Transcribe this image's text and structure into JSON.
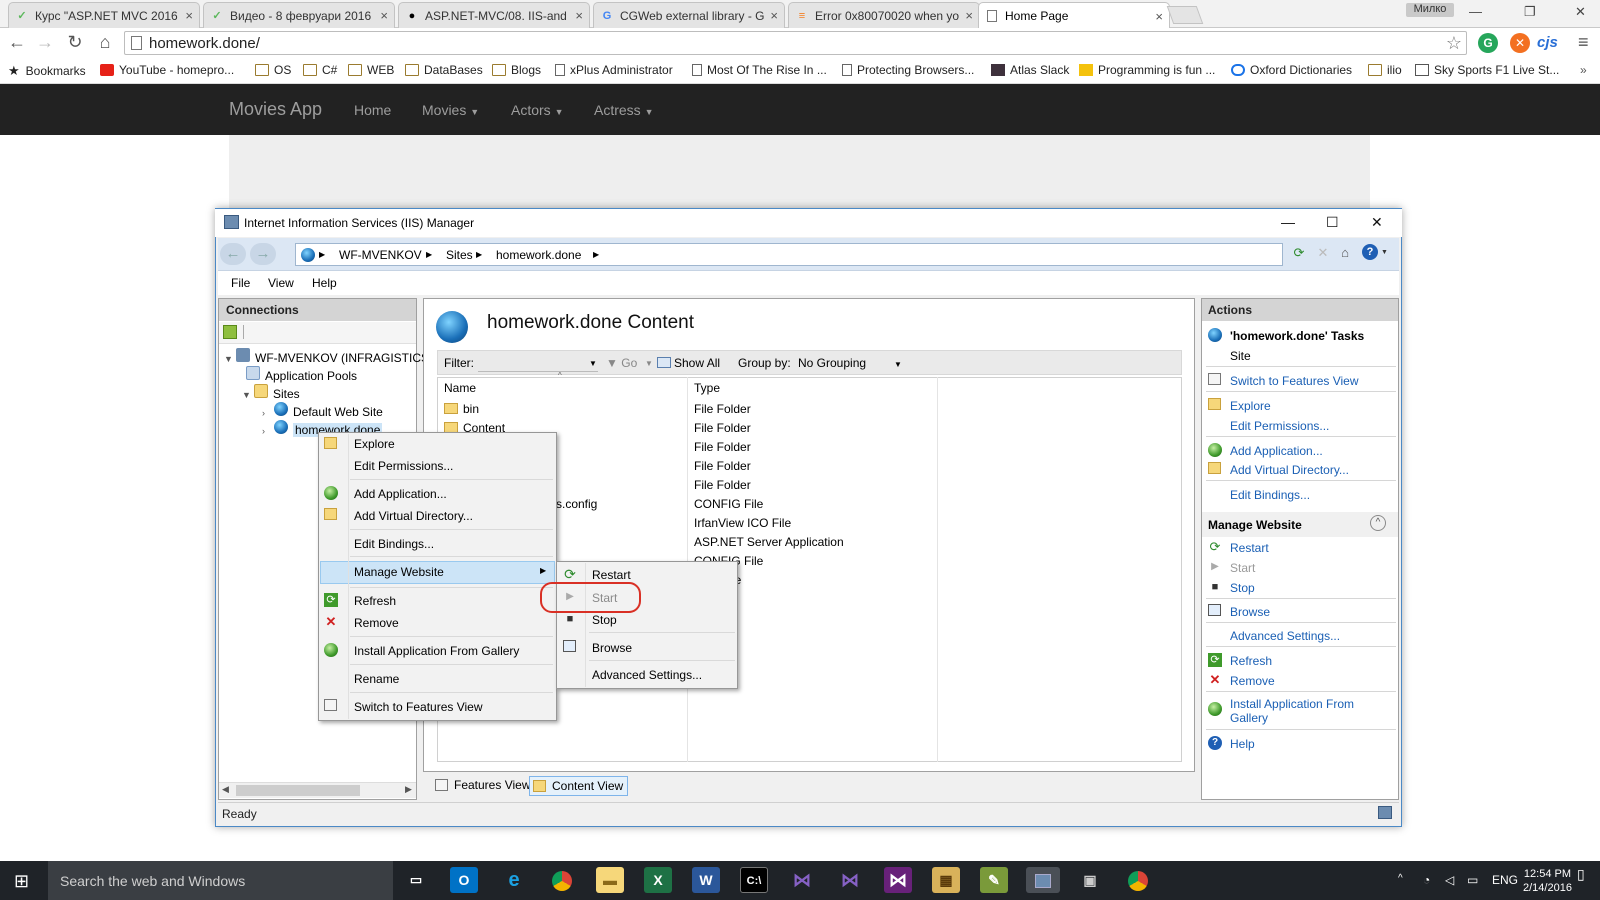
{
  "browser": {
    "tabs": [
      {
        "title": "Курс \"ASP.NET MVC 2016",
        "favicon": "telerik-icon",
        "color": "#5cb85c"
      },
      {
        "title": "Видео - 8 февруари 2016",
        "favicon": "telerik-icon",
        "color": "#5cb85c"
      },
      {
        "title": "ASP.NET-MVC/08. IIS-and",
        "favicon": "github-icon",
        "color": "#000000"
      },
      {
        "title": "CGWeb external library - G",
        "favicon": "google-icon",
        "color": "#4285f4"
      },
      {
        "title": "Error 0x80070020 when yo",
        "favicon": "stack-icon",
        "color": "#f48024"
      },
      {
        "title": "Home Page",
        "favicon": "page-icon",
        "color": "#888888"
      }
    ],
    "user": "Милко",
    "url": "homework.done/",
    "extension_cjs": "cjs",
    "bookmarks": [
      {
        "label": "Bookmarks",
        "icon": "star-icon"
      },
      {
        "label": "YouTube - homepro...",
        "icon": "youtube-icon"
      },
      {
        "label": "OS",
        "icon": "folder-icon"
      },
      {
        "label": "C#",
        "icon": "folder-icon"
      },
      {
        "label": "WEB",
        "icon": "folder-icon"
      },
      {
        "label": "DataBases",
        "icon": "folder-icon"
      },
      {
        "label": "Blogs",
        "icon": "folder-icon"
      },
      {
        "label": "xPlus Administrator",
        "icon": "page-icon"
      },
      {
        "label": "Most Of The Rise In ...",
        "icon": "page-icon"
      },
      {
        "label": "Protecting Browsers...",
        "icon": "page-icon"
      },
      {
        "label": "Atlas Slack",
        "icon": "slack-icon"
      },
      {
        "label": "Programming is fun ...",
        "icon": "pen-icon"
      },
      {
        "label": "Oxford Dictionaries",
        "icon": "oxford-icon"
      },
      {
        "label": "ilio",
        "icon": "folder-icon"
      },
      {
        "label": "Sky Sports F1 Live St...",
        "icon": "sky-icon"
      }
    ]
  },
  "site": {
    "brand": "Movies App",
    "nav": [
      "Home",
      "Movies",
      "Actors",
      "Actress"
    ]
  },
  "iis": {
    "title": "Internet Information Services (IIS) Manager",
    "breadcrumb": [
      "WF-MVENKOV",
      "Sites",
      "homework.done"
    ],
    "menu": [
      "File",
      "View",
      "Help"
    ],
    "connections": {
      "header": "Connections",
      "tree": [
        {
          "label": "WF-MVENKOV (INFRAGISTICS"
        },
        {
          "label": "Application Pools"
        },
        {
          "label": "Sites"
        },
        {
          "label": "Default Web Site"
        },
        {
          "label": "homework.done"
        }
      ]
    },
    "content": {
      "title": "homework.done Content",
      "filter_label": "Filter:",
      "go_label": "Go",
      "show_all": "Show All",
      "group_by_label": "Group by:",
      "group_by_value": "No Grouping",
      "columns": [
        "Name",
        "Type"
      ],
      "rows": [
        {
          "name": "bin",
          "type": "File Folder"
        },
        {
          "name": "Content",
          "type": "File Folder"
        },
        {
          "name": "",
          "type": "File Folder"
        },
        {
          "name": "",
          "type": "File Folder"
        },
        {
          "name": "",
          "type": "File Folder"
        },
        {
          "name": "s.config",
          "type": "CONFIG File"
        },
        {
          "name": "",
          "type": "IrfanView ICO File"
        },
        {
          "name": "",
          "type": "ASP.NET Server Application"
        },
        {
          "name": "",
          "type": "CONFIG File"
        },
        {
          "name": "",
          "type": "File"
        }
      ],
      "bottom_tabs": [
        "Features View",
        "Content View"
      ]
    },
    "actions": {
      "header": "Actions",
      "task_title": "'homework.done' Tasks",
      "site_label": "Site",
      "items1": [
        "Switch to Features View",
        "Explore",
        "Edit Permissions...",
        "Add Application...",
        "Add Virtual Directory...",
        "Edit Bindings..."
      ],
      "manage_header": "Manage Website",
      "items2": [
        "Restart",
        "Start",
        "Stop",
        "Browse",
        "Advanced Settings...",
        "Refresh",
        "Remove",
        "Install Application From",
        "Gallery",
        "Help"
      ]
    },
    "status": "Ready",
    "context_menu": [
      "Explore",
      "Edit Permissions...",
      "Add Application...",
      "Add Virtual Directory...",
      "Edit Bindings...",
      "Manage Website",
      "Refresh",
      "Remove",
      "Install Application From Gallery",
      "Rename",
      "Switch to Features View"
    ],
    "submenu": [
      "Restart",
      "Start",
      "Stop",
      "Browse",
      "Advanced Settings..."
    ]
  },
  "taskbar": {
    "search_placeholder": "Search the web and Windows",
    "language": "ENG",
    "time": "12:54 PM",
    "date": "2/14/2016"
  }
}
